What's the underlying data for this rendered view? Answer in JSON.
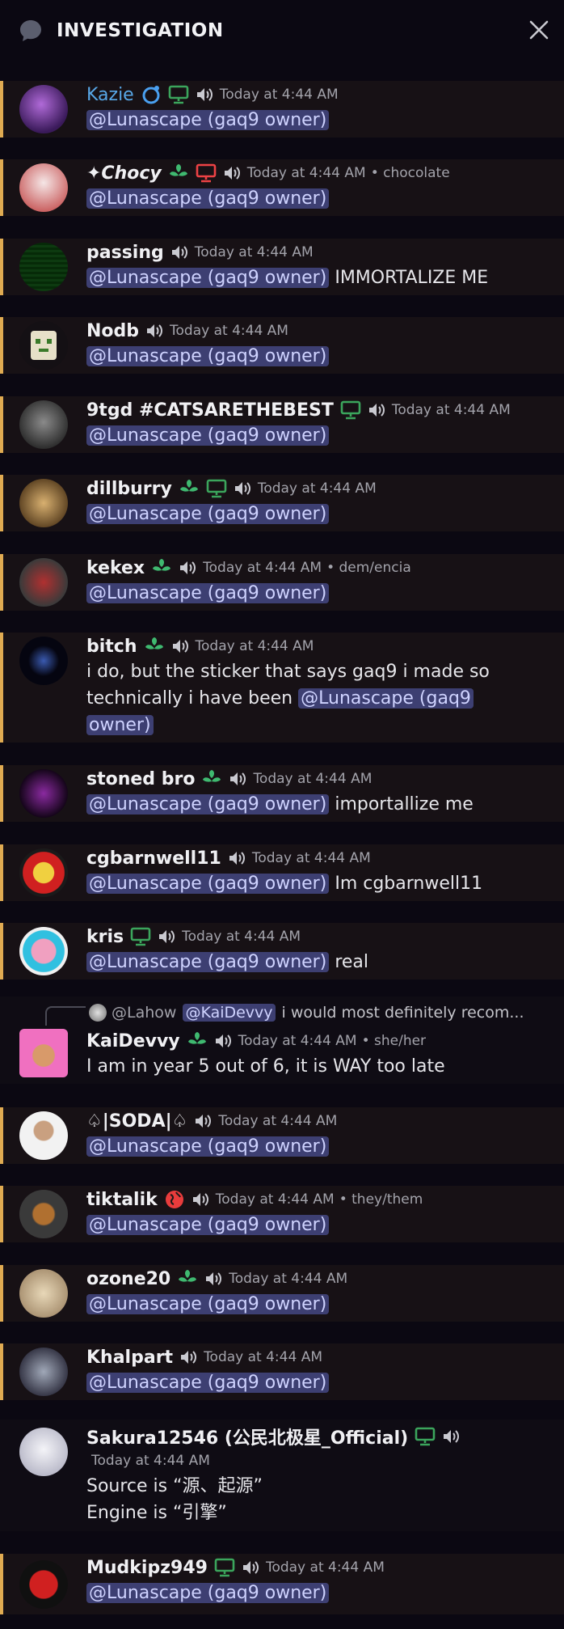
{
  "header": {
    "title": "INVESTIGATION"
  },
  "mention": "@Lunascape (gaq9 owner)",
  "messages": [
    {
      "user": "Kazie",
      "time": "Today at 4:44 AM"
    },
    {
      "user": "✦Chocy",
      "time": "Today at 4:44 AM",
      "pronouns": "• chocolate"
    },
    {
      "user": "passing",
      "time": "Today at 4:44 AM",
      "suffix": "IMMORTALIZE ME"
    },
    {
      "user": "Nodb",
      "time": "Today at 4:44 AM"
    },
    {
      "user": "9tgd #CATSARETHEBEST",
      "time": "Today at 4:44 AM"
    },
    {
      "user": "dillburry",
      "time": "Today at 4:44 AM"
    },
    {
      "user": "kekex",
      "time": "Today at 4:44 AM",
      "pronouns": "• dem/encia"
    },
    {
      "user": "bitch",
      "time": "Today at 4:44 AM",
      "text1": "i do, but the sticker that says gaq9 i made so",
      "text2": "technically i have been",
      "mention_a": "@Lunascape (gaq9",
      "mention_b": "owner)"
    },
    {
      "user": "stoned bro",
      "time": "Today at 4:44 AM",
      "suffix": "importallize me"
    },
    {
      "user": "cgbarnwell11",
      "time": "Today at 4:44 AM",
      "suffix": "Im cgbarnwell11"
    },
    {
      "user": "kris",
      "time": "Today at 4:44 AM",
      "suffix": "real"
    },
    {
      "user": "KaiDevvy",
      "time": "Today at 4:44 AM",
      "pronouns": "• she/her",
      "reply_user": "@Lahow",
      "reply_mention": "@KaiDevvy",
      "reply_text": "i would most definitely recom...",
      "text": "I am in year 5 out of 6, it is WAY too late"
    },
    {
      "user": "♤|SODA|♤",
      "time": "Today at 4:44 AM"
    },
    {
      "user": "tiktalik",
      "time": "Today at 4:44 AM",
      "pronouns": "• they/them"
    },
    {
      "user": "ozone20",
      "time": "Today at 4:44 AM"
    },
    {
      "user": "Khalpart",
      "time": "Today at 4:44 AM"
    },
    {
      "user": "Sakura12546 (公民北极星_Official)",
      "time": "Today at 4:44 AM",
      "text1": "Source is “源、起源”",
      "text2": "Engine is “引擎”"
    },
    {
      "user": "Mudkipz949",
      "time": "Today at 4:44 AM"
    }
  ]
}
